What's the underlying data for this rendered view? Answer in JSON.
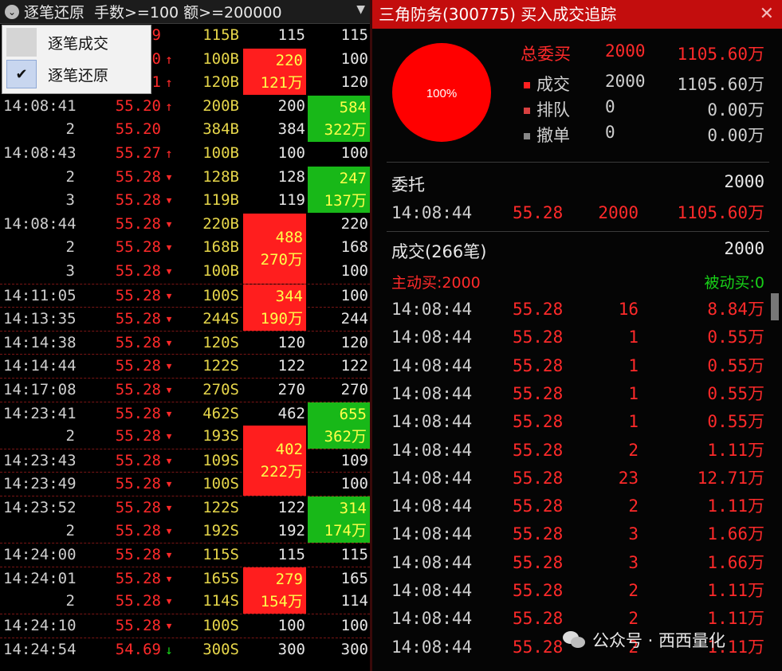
{
  "left_panel": {
    "title": "逐笔还原",
    "filter_text": "手数>=100 额>=200000",
    "menu": [
      {
        "label": "逐笔成交",
        "checked": false
      },
      {
        "label": "逐笔还原",
        "checked": true
      }
    ],
    "rows": [
      {
        "time": "",
        "price": "",
        "arrow": "",
        "vol": "115B",
        "v1": "115",
        "v2": "115",
        "partial_top": "9"
      },
      {
        "time": "",
        "price": "",
        "arrow": "up",
        "vol": "100B",
        "v1": "",
        "v2": "100",
        "partial": "0"
      },
      {
        "time": "",
        "price": "",
        "arrow": "up",
        "vol": "120B",
        "v1": "",
        "v2": "120",
        "partial": "1"
      },
      {
        "time": "14:08:41",
        "price": "55.20",
        "arrow": "up",
        "vol": "200B",
        "v1": "200",
        "v2": ""
      },
      {
        "time": "2",
        "price": "55.20",
        "arrow": "",
        "vol": "384B",
        "v1": "384",
        "v2": ""
      },
      {
        "time": "14:08:43",
        "price": "55.27",
        "arrow": "up",
        "vol": "100B",
        "v1": "100",
        "v2": "100"
      },
      {
        "time": "2",
        "price": "55.28",
        "arrow": "down",
        "vol": "128B",
        "v1": "128",
        "v2": ""
      },
      {
        "time": "3",
        "price": "55.28",
        "arrow": "down",
        "vol": "119B",
        "v1": "119",
        "v2": ""
      },
      {
        "time": "14:08:44",
        "price": "55.28",
        "arrow": "down",
        "vol": "220B",
        "v1": "",
        "v2": "220"
      },
      {
        "time": "2",
        "price": "55.28",
        "arrow": "down",
        "vol": "168B",
        "v1": "",
        "v2": "168"
      },
      {
        "time": "3",
        "price": "55.28",
        "arrow": "down",
        "vol": "100B",
        "v1": "",
        "v2": "100"
      },
      {
        "time": "14:11:05",
        "price": "55.28",
        "arrow": "down",
        "vol": "100S",
        "v1": "",
        "v2": "100",
        "sep": true
      },
      {
        "time": "14:13:35",
        "price": "55.28",
        "arrow": "down",
        "vol": "244S",
        "v1": "",
        "v2": "244",
        "sep": true
      },
      {
        "time": "14:14:38",
        "price": "55.28",
        "arrow": "down",
        "vol": "120S",
        "v1": "120",
        "v2": "120",
        "sep": true
      },
      {
        "time": "14:14:44",
        "price": "55.28",
        "arrow": "down",
        "vol": "122S",
        "v1": "122",
        "v2": "122",
        "sep": true
      },
      {
        "time": "14:17:08",
        "price": "55.28",
        "arrow": "down",
        "vol": "270S",
        "v1": "270",
        "v2": "270",
        "sep": true
      },
      {
        "time": "14:23:41",
        "price": "55.28",
        "arrow": "down",
        "vol": "462S",
        "v1": "462",
        "v2": "",
        "sep": true
      },
      {
        "time": "2",
        "price": "55.28",
        "arrow": "down",
        "vol": "193S",
        "v1": "",
        "v2": ""
      },
      {
        "time": "14:23:43",
        "price": "55.28",
        "arrow": "down",
        "vol": "109S",
        "v1": "",
        "v2": "109",
        "sep": true
      },
      {
        "time": "14:23:49",
        "price": "55.28",
        "arrow": "down",
        "vol": "100S",
        "v1": "",
        "v2": "100",
        "sep": true
      },
      {
        "time": "14:23:52",
        "price": "55.28",
        "arrow": "down",
        "vol": "122S",
        "v1": "122",
        "v2": "",
        "sep": true
      },
      {
        "time": "2",
        "price": "55.28",
        "arrow": "down",
        "vol": "192S",
        "v1": "192",
        "v2": ""
      },
      {
        "time": "14:24:00",
        "price": "55.28",
        "arrow": "down",
        "vol": "115S",
        "v1": "115",
        "v2": "115",
        "sep": true
      },
      {
        "time": "14:24:01",
        "price": "55.28",
        "arrow": "down",
        "vol": "165S",
        "v1": "",
        "v2": "165",
        "sep": true
      },
      {
        "time": "2",
        "price": "55.28",
        "arrow": "down",
        "vol": "114S",
        "v1": "",
        "v2": "114"
      },
      {
        "time": "14:24:10",
        "price": "55.28",
        "arrow": "down",
        "vol": "100S",
        "v1": "100",
        "v2": "100",
        "sep": true
      },
      {
        "time": "14:24:54",
        "price": "54.69",
        "arrow": "down-green",
        "vol": "300S",
        "v1": "300",
        "v2": "300",
        "sep": true
      }
    ],
    "blocks": [
      {
        "kind": "r",
        "row": 1,
        "span": 2,
        "line1": "220",
        "line2": "121万"
      },
      {
        "kind": "g",
        "row": 3,
        "span": 2,
        "line1": "584",
        "line2": "322万"
      },
      {
        "kind": "g",
        "row": 6,
        "span": 2,
        "line1": "247",
        "line2": "137万"
      },
      {
        "kind": "r",
        "row": 8,
        "span": 3,
        "line1": "488",
        "line2": "270万"
      },
      {
        "kind": "r",
        "row": 11,
        "span": 2,
        "line1": "344",
        "line2": "190万"
      },
      {
        "kind": "g",
        "row": 16,
        "span": 2,
        "line1": "655",
        "line2": "362万"
      },
      {
        "kind": "r",
        "row": 17,
        "span": 3,
        "line1": "402",
        "line2": "222万"
      },
      {
        "kind": "g",
        "row": 20,
        "span": 2,
        "line1": "314",
        "line2": "174万"
      },
      {
        "kind": "r",
        "row": 23,
        "span": 2,
        "line1": "279",
        "line2": "154万"
      }
    ]
  },
  "right_panel": {
    "title": "三角防务(300775) 买入成交追踪",
    "pie_label": "100%",
    "colors": {
      "red": "#ff0000",
      "accent": "#c30d0d"
    },
    "summary": {
      "total": {
        "label": "总委买",
        "qty": "2000",
        "amount": "1105.60万"
      },
      "items": [
        {
          "label": "成交",
          "qty": "2000",
          "amount": "1105.60万",
          "color": "#ff2020"
        },
        {
          "label": "排队",
          "qty": "0",
          "amount": "0.00万",
          "color": "#d84040"
        },
        {
          "label": "撤单",
          "qty": "0",
          "amount": "0.00万",
          "color": "#888888"
        }
      ]
    },
    "order": {
      "title": "委托",
      "total": "2000",
      "row": {
        "time": "14:08:44",
        "price": "55.28",
        "qty": "2000",
        "amount": "1105.60万"
      }
    },
    "trades": {
      "title": "成交(266笔)",
      "total": "2000",
      "active_buy": "主动买:2000",
      "passive_buy": "被动买:0",
      "rows": [
        {
          "time": "14:08:44",
          "price": "55.28",
          "qty": "16",
          "amount": "8.84万"
        },
        {
          "time": "14:08:44",
          "price": "55.28",
          "qty": "1",
          "amount": "0.55万"
        },
        {
          "time": "14:08:44",
          "price": "55.28",
          "qty": "1",
          "amount": "0.55万"
        },
        {
          "time": "14:08:44",
          "price": "55.28",
          "qty": "1",
          "amount": "0.55万"
        },
        {
          "time": "14:08:44",
          "price": "55.28",
          "qty": "1",
          "amount": "0.55万"
        },
        {
          "time": "14:08:44",
          "price": "55.28",
          "qty": "2",
          "amount": "1.11万"
        },
        {
          "time": "14:08:44",
          "price": "55.28",
          "qty": "23",
          "amount": "12.71万"
        },
        {
          "time": "14:08:44",
          "price": "55.28",
          "qty": "2",
          "amount": "1.11万"
        },
        {
          "time": "14:08:44",
          "price": "55.28",
          "qty": "3",
          "amount": "1.66万"
        },
        {
          "time": "14:08:44",
          "price": "55.28",
          "qty": "3",
          "amount": "1.66万"
        },
        {
          "time": "14:08:44",
          "price": "55.28",
          "qty": "2",
          "amount": "1.11万"
        },
        {
          "time": "14:08:44",
          "price": "55.28",
          "qty": "2",
          "amount": "1.11万"
        },
        {
          "time": "14:08:44",
          "price": "55.28",
          "qty": "2",
          "amount": "1.11万"
        }
      ]
    },
    "watermark": "公众号 · 西西量化"
  }
}
